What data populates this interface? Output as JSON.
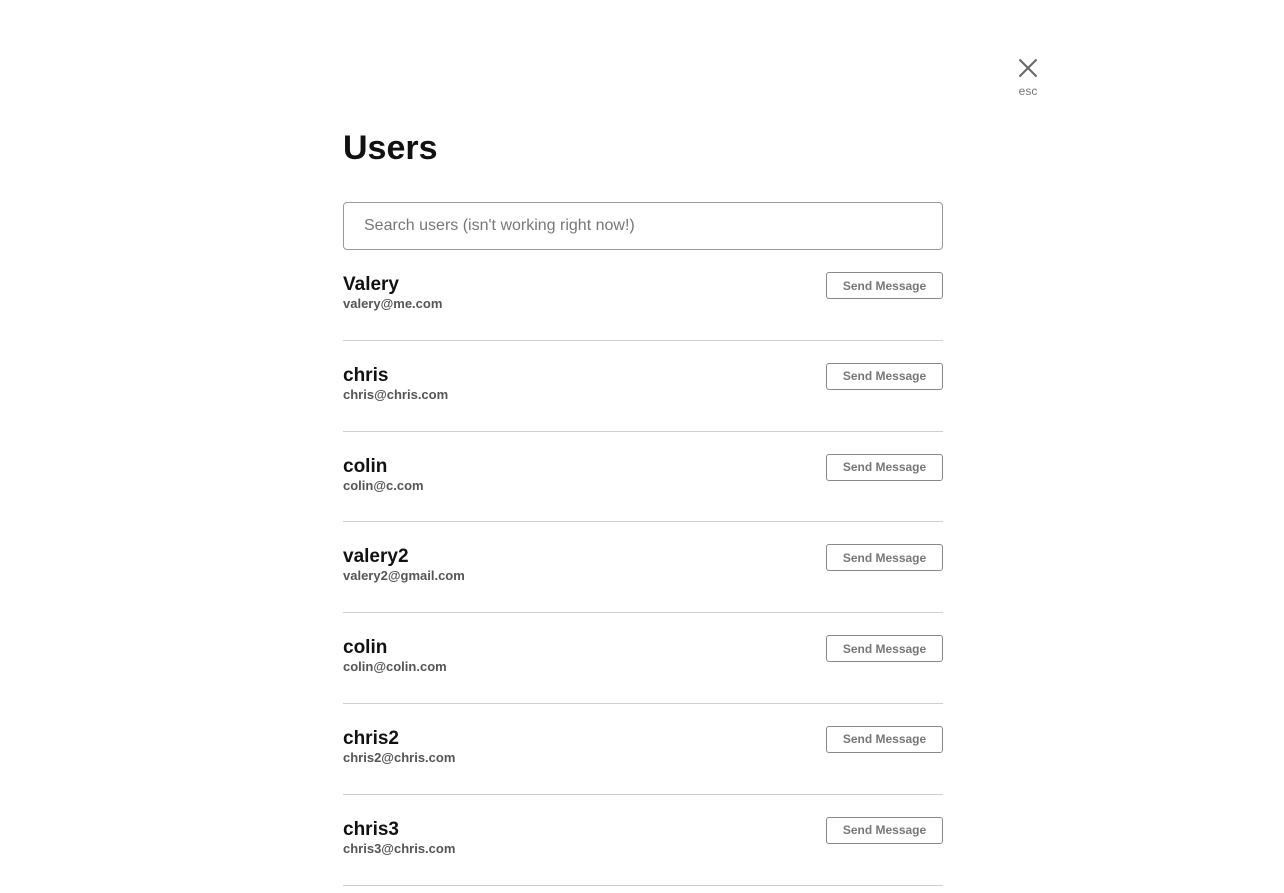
{
  "close": {
    "icon": "close-icon",
    "label": "esc"
  },
  "header": {
    "title": "Users"
  },
  "search": {
    "placeholder": "Search users (isn't working right now!)",
    "value": ""
  },
  "users": [
    {
      "name": "Valery",
      "email": "valery@me.com",
      "action": "Send Message"
    },
    {
      "name": "chris",
      "email": "chris@chris.com",
      "action": "Send Message"
    },
    {
      "name": "colin",
      "email": "colin@c.com",
      "action": "Send Message"
    },
    {
      "name": "valery2",
      "email": "valery2@gmail.com",
      "action": "Send Message"
    },
    {
      "name": "colin",
      "email": "colin@colin.com",
      "action": "Send Message"
    },
    {
      "name": "chris2",
      "email": "chris2@chris.com",
      "action": "Send Message"
    },
    {
      "name": "chris3",
      "email": "chris3@chris.com",
      "action": "Send Message"
    }
  ]
}
